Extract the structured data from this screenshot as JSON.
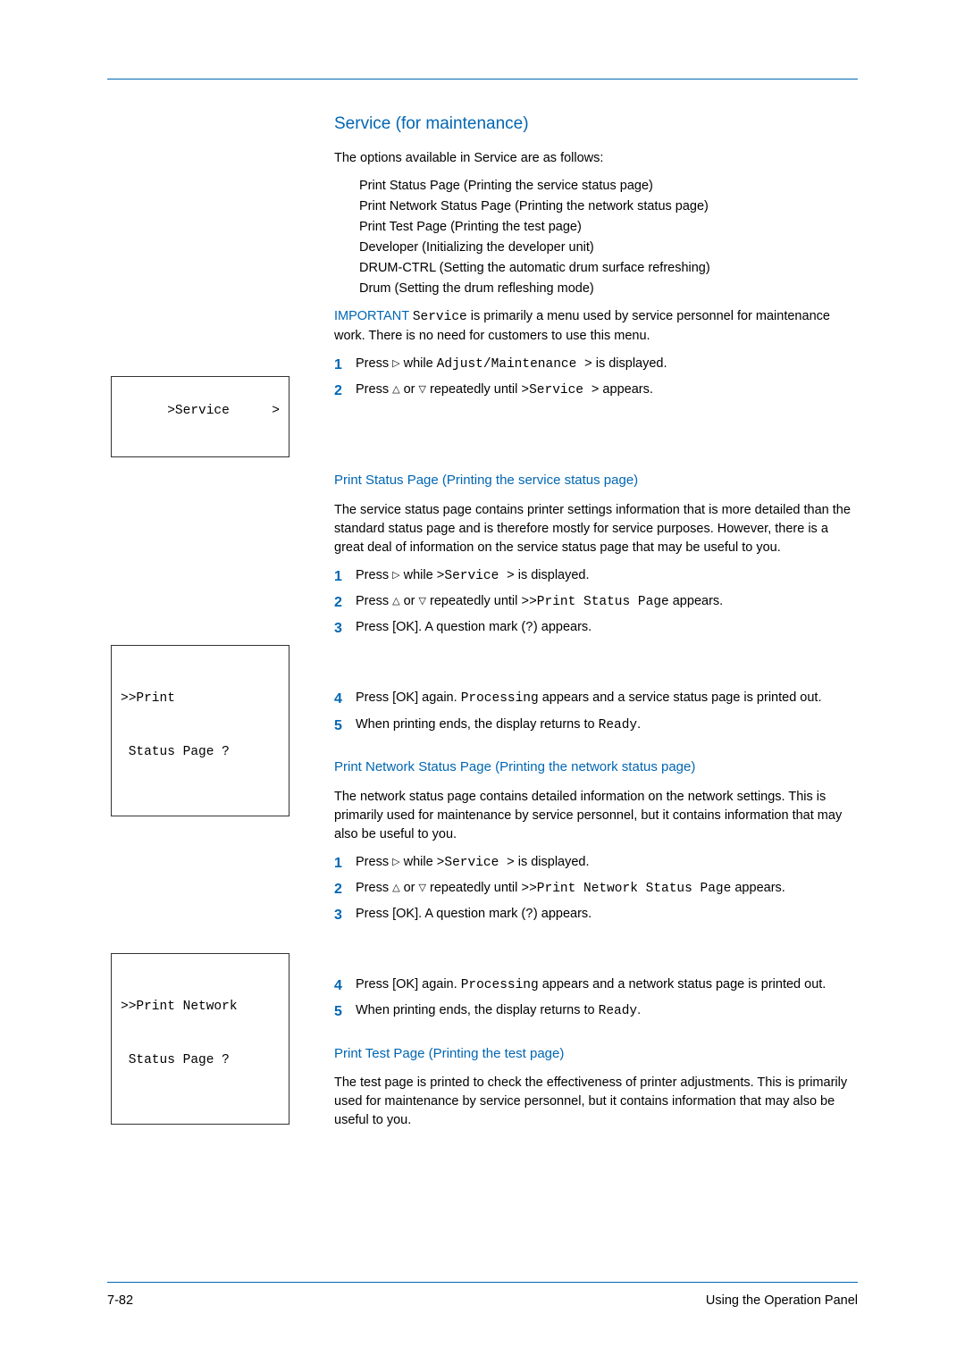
{
  "heading": "Service (for maintenance)",
  "intro": "The options available in Service are as follows:",
  "options": [
    "Print Status Page (Printing the service status page)",
    "Print Network Status Page (Printing the network status page)",
    "Print Test Page (Printing the test page)",
    "Developer (Initializing the developer unit)",
    "DRUM-CTRL (Setting the automatic drum surface refreshing)",
    "Drum (Setting the drum refleshing mode)"
  ],
  "important_label": "IMPORTANT",
  "important_body_pre": "Service",
  "important_body": " is primarily a menu used by service personnel for maintenance work. There is no need for customers to use this menu.",
  "svc_steps": {
    "s1a": "Press ",
    "s1b": " while ",
    "s1_code": "Adjust/Maintenance >",
    "s1c": " is displayed.",
    "s2a": "Press ",
    "s2b": " or ",
    "s2c": " repeatedly until ",
    "s2_code": ">Service >",
    "s2d": " appears."
  },
  "lcd1_line1": ">Service",
  "lcd1_arrow": ">",
  "sec_psp": {
    "title": "Print Status Page (Printing the service status page)",
    "body": "The service status page contains printer settings information that is more detailed than the standard status page and is therefore mostly for service purposes. However, there is a great deal of information on the service status page that may be useful to you.",
    "s1a": "Press ",
    "s1b": " while ",
    "s1_code": ">Service >",
    "s1c": " is displayed.",
    "s2a": "Press ",
    "s2b": " or ",
    "s2c": " repeatedly until ",
    "s2_code": ">>Print Status Page",
    "s2d": " appears.",
    "s3a": "Press ",
    "s3_ok": "[OK]",
    "s3b": ". A question mark (",
    "s3_code": "?",
    "s3c": ") appears.",
    "s4a": "Press ",
    "s4_ok": "[OK]",
    "s4b": " again. ",
    "s4_code": "Processing",
    "s4c": " appears and a service status page is printed out.",
    "s5a": "When printing ends, the display returns to ",
    "s5_code": "Ready",
    "s5b": "."
  },
  "lcd2_line1": ">>Print",
  "lcd2_line2": " Status Page ?",
  "sec_pnsp": {
    "title": "Print Network Status Page (Printing the network status page)",
    "body": "The network status page contains detailed information on the network settings. This is primarily used for maintenance by service personnel, but it contains information that may also be useful to you.",
    "s1a": "Press ",
    "s1b": " while ",
    "s1_code": ">Service >",
    "s1c": " is displayed.",
    "s2a": "Press ",
    "s2b": " or ",
    "s2c": " repeatedly until ",
    "s2_code": ">>Print Network Status Page",
    "s2d": " appears.",
    "s3a": "Press ",
    "s3_ok": "[OK]",
    "s3b": ". A question mark (",
    "s3_code": "?",
    "s3c": ") appears.",
    "s4a": "Press ",
    "s4_ok": "[OK]",
    "s4b": " again. ",
    "s4_code": "Processing",
    "s4c": " appears and a network status page is printed out.",
    "s5a": "When printing ends, the display returns to ",
    "s5_code": "Ready",
    "s5b": "."
  },
  "lcd3_line1": ">>Print Network",
  "lcd3_line2": " Status Page ?",
  "sec_ptp": {
    "title": "Print Test Page (Printing the test page)",
    "body": "The test page is printed to check the effectiveness of printer adjustments. This is primarily used for maintenance by service personnel, but it contains information that may also be useful to you."
  },
  "footer": {
    "page": "7-82",
    "title": "Using the Operation Panel"
  },
  "glyphs": {
    "right": "▷",
    "up": "△",
    "down": "▽"
  }
}
